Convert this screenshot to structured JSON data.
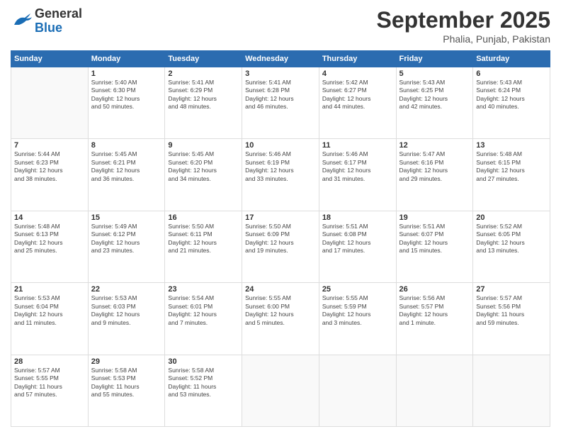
{
  "header": {
    "logo_line1": "General",
    "logo_line2": "Blue",
    "month": "September 2025",
    "location": "Phalia, Punjab, Pakistan"
  },
  "days_of_week": [
    "Sunday",
    "Monday",
    "Tuesday",
    "Wednesday",
    "Thursday",
    "Friday",
    "Saturday"
  ],
  "weeks": [
    [
      {
        "day": "",
        "info": ""
      },
      {
        "day": "1",
        "info": "Sunrise: 5:40 AM\nSunset: 6:30 PM\nDaylight: 12 hours\nand 50 minutes."
      },
      {
        "day": "2",
        "info": "Sunrise: 5:41 AM\nSunset: 6:29 PM\nDaylight: 12 hours\nand 48 minutes."
      },
      {
        "day": "3",
        "info": "Sunrise: 5:41 AM\nSunset: 6:28 PM\nDaylight: 12 hours\nand 46 minutes."
      },
      {
        "day": "4",
        "info": "Sunrise: 5:42 AM\nSunset: 6:27 PM\nDaylight: 12 hours\nand 44 minutes."
      },
      {
        "day": "5",
        "info": "Sunrise: 5:43 AM\nSunset: 6:25 PM\nDaylight: 12 hours\nand 42 minutes."
      },
      {
        "day": "6",
        "info": "Sunrise: 5:43 AM\nSunset: 6:24 PM\nDaylight: 12 hours\nand 40 minutes."
      }
    ],
    [
      {
        "day": "7",
        "info": "Sunrise: 5:44 AM\nSunset: 6:23 PM\nDaylight: 12 hours\nand 38 minutes."
      },
      {
        "day": "8",
        "info": "Sunrise: 5:45 AM\nSunset: 6:21 PM\nDaylight: 12 hours\nand 36 minutes."
      },
      {
        "day": "9",
        "info": "Sunrise: 5:45 AM\nSunset: 6:20 PM\nDaylight: 12 hours\nand 34 minutes."
      },
      {
        "day": "10",
        "info": "Sunrise: 5:46 AM\nSunset: 6:19 PM\nDaylight: 12 hours\nand 33 minutes."
      },
      {
        "day": "11",
        "info": "Sunrise: 5:46 AM\nSunset: 6:17 PM\nDaylight: 12 hours\nand 31 minutes."
      },
      {
        "day": "12",
        "info": "Sunrise: 5:47 AM\nSunset: 6:16 PM\nDaylight: 12 hours\nand 29 minutes."
      },
      {
        "day": "13",
        "info": "Sunrise: 5:48 AM\nSunset: 6:15 PM\nDaylight: 12 hours\nand 27 minutes."
      }
    ],
    [
      {
        "day": "14",
        "info": "Sunrise: 5:48 AM\nSunset: 6:13 PM\nDaylight: 12 hours\nand 25 minutes."
      },
      {
        "day": "15",
        "info": "Sunrise: 5:49 AM\nSunset: 6:12 PM\nDaylight: 12 hours\nand 23 minutes."
      },
      {
        "day": "16",
        "info": "Sunrise: 5:50 AM\nSunset: 6:11 PM\nDaylight: 12 hours\nand 21 minutes."
      },
      {
        "day": "17",
        "info": "Sunrise: 5:50 AM\nSunset: 6:09 PM\nDaylight: 12 hours\nand 19 minutes."
      },
      {
        "day": "18",
        "info": "Sunrise: 5:51 AM\nSunset: 6:08 PM\nDaylight: 12 hours\nand 17 minutes."
      },
      {
        "day": "19",
        "info": "Sunrise: 5:51 AM\nSunset: 6:07 PM\nDaylight: 12 hours\nand 15 minutes."
      },
      {
        "day": "20",
        "info": "Sunrise: 5:52 AM\nSunset: 6:05 PM\nDaylight: 12 hours\nand 13 minutes."
      }
    ],
    [
      {
        "day": "21",
        "info": "Sunrise: 5:53 AM\nSunset: 6:04 PM\nDaylight: 12 hours\nand 11 minutes."
      },
      {
        "day": "22",
        "info": "Sunrise: 5:53 AM\nSunset: 6:03 PM\nDaylight: 12 hours\nand 9 minutes."
      },
      {
        "day": "23",
        "info": "Sunrise: 5:54 AM\nSunset: 6:01 PM\nDaylight: 12 hours\nand 7 minutes."
      },
      {
        "day": "24",
        "info": "Sunrise: 5:55 AM\nSunset: 6:00 PM\nDaylight: 12 hours\nand 5 minutes."
      },
      {
        "day": "25",
        "info": "Sunrise: 5:55 AM\nSunset: 5:59 PM\nDaylight: 12 hours\nand 3 minutes."
      },
      {
        "day": "26",
        "info": "Sunrise: 5:56 AM\nSunset: 5:57 PM\nDaylight: 12 hours\nand 1 minute."
      },
      {
        "day": "27",
        "info": "Sunrise: 5:57 AM\nSunset: 5:56 PM\nDaylight: 11 hours\nand 59 minutes."
      }
    ],
    [
      {
        "day": "28",
        "info": "Sunrise: 5:57 AM\nSunset: 5:55 PM\nDaylight: 11 hours\nand 57 minutes."
      },
      {
        "day": "29",
        "info": "Sunrise: 5:58 AM\nSunset: 5:53 PM\nDaylight: 11 hours\nand 55 minutes."
      },
      {
        "day": "30",
        "info": "Sunrise: 5:58 AM\nSunset: 5:52 PM\nDaylight: 11 hours\nand 53 minutes."
      },
      {
        "day": "",
        "info": ""
      },
      {
        "day": "",
        "info": ""
      },
      {
        "day": "",
        "info": ""
      },
      {
        "day": "",
        "info": ""
      }
    ]
  ]
}
